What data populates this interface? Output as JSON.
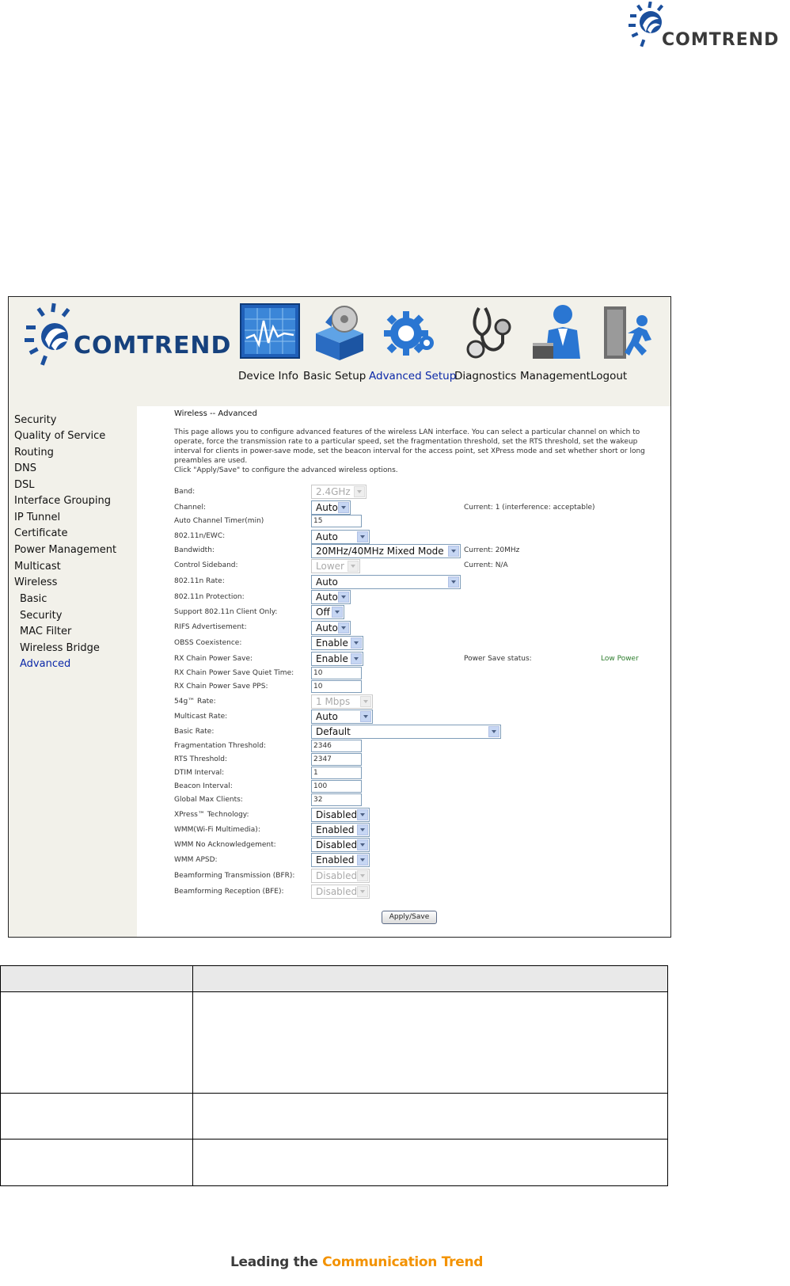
{
  "brand": {
    "name": "COMTREND"
  },
  "nav": {
    "items": [
      {
        "label": "Device Info",
        "icon": "device-info-chart-icon",
        "active": false
      },
      {
        "label": "Basic Setup",
        "icon": "basic-setup-box-icon",
        "active": false
      },
      {
        "label": "Advanced Setup",
        "icon": "advanced-setup-gear-icon",
        "active": true
      },
      {
        "label": "Diagnostics",
        "icon": "diagnostics-stethoscope-icon",
        "active": false
      },
      {
        "label": "Management",
        "icon": "management-person-icon",
        "active": false
      },
      {
        "label": "Logout",
        "icon": "logout-running-man-icon",
        "active": false
      }
    ]
  },
  "sidebar": {
    "items": [
      {
        "label": "Security"
      },
      {
        "label": "Quality of Service"
      },
      {
        "label": "Routing"
      },
      {
        "label": "DNS"
      },
      {
        "label": "DSL"
      },
      {
        "label": "Interface Grouping"
      },
      {
        "label": "IP Tunnel"
      },
      {
        "label": "Certificate"
      },
      {
        "label": "Power Management"
      },
      {
        "label": "Multicast"
      },
      {
        "label": "Wireless"
      },
      {
        "label": "Basic"
      },
      {
        "label": "Security"
      },
      {
        "label": "MAC Filter"
      },
      {
        "label": "Wireless Bridge"
      },
      {
        "label": "Advanced",
        "active": true
      }
    ]
  },
  "page": {
    "title": "Wireless -- Advanced",
    "description_1": "This page allows you to configure advanced features of the wireless LAN interface. You can select a particular channel on which to operate, force the transmission rate to a particular speed, set the fragmentation threshold, set the RTS threshold, set the wakeup interval for clients in power-save mode, set the beacon interval for the access point, set XPress mode and set whether short or long preambles are used.",
    "description_2": "Click \"Apply/Save\" to configure the advanced wireless options."
  },
  "form": {
    "band": {
      "label": "Band:",
      "value": "2.4GHz",
      "disabled": true
    },
    "channel": {
      "label": "Channel:",
      "value": "Auto",
      "note": "Current: 1 (interference: acceptable)"
    },
    "auto_channel_timer": {
      "label": "Auto Channel Timer(min)",
      "value": "15"
    },
    "ewc": {
      "label": "802.11n/EWC:",
      "value": "Auto"
    },
    "bandwidth": {
      "label": "Bandwidth:",
      "value": "20MHz/40MHz Mixed Mode",
      "note": "Current: 20MHz"
    },
    "control_sideband": {
      "label": "Control Sideband:",
      "value": "Lower",
      "disabled": true,
      "note": "Current: N/A"
    },
    "n_rate": {
      "label": "802.11n Rate:",
      "value": "Auto"
    },
    "n_protection": {
      "label": "802.11n Protection:",
      "value": "Auto"
    },
    "support_n_only": {
      "label": "Support 802.11n Client Only:",
      "value": "Off"
    },
    "rifs": {
      "label": "RIFS Advertisement:",
      "value": "Auto"
    },
    "obss": {
      "label": "OBSS Coexistence:",
      "value": "Enable"
    },
    "rx_chain_power_save": {
      "label": "RX Chain Power Save:",
      "value": "Enable",
      "note": "Power Save status:",
      "status": "Low Power"
    },
    "rx_quiet_time": {
      "label": "RX Chain Power Save Quiet Time:",
      "value": "10"
    },
    "rx_pps": {
      "label": "RX Chain Power Save PPS:",
      "value": "10"
    },
    "rate_54g": {
      "label": "54g™ Rate:",
      "value": "1 Mbps",
      "disabled": true
    },
    "multicast_rate": {
      "label": "Multicast Rate:",
      "value": "Auto"
    },
    "basic_rate": {
      "label": "Basic Rate:",
      "value": "Default"
    },
    "frag_threshold": {
      "label": "Fragmentation Threshold:",
      "value": "2346"
    },
    "rts_threshold": {
      "label": "RTS Threshold:",
      "value": "2347"
    },
    "dtim": {
      "label": "DTIM Interval:",
      "value": "1"
    },
    "beacon": {
      "label": "Beacon Interval:",
      "value": "100"
    },
    "max_clients": {
      "label": "Global Max Clients:",
      "value": "32"
    },
    "xpress": {
      "label": "XPress™ Technology:",
      "value": "Disabled"
    },
    "wmm": {
      "label": "WMM(Wi-Fi Multimedia):",
      "value": "Enabled"
    },
    "wmm_noack": {
      "label": "WMM No Acknowledgement:",
      "value": "Disabled"
    },
    "wmm_apsd": {
      "label": "WMM APSD:",
      "value": "Enabled"
    },
    "bfr": {
      "label": "Beamforming Transmission (BFR):",
      "value": "Disabled",
      "disabled": true
    },
    "bfe": {
      "label": "Beamforming Reception (BFE):",
      "value": "Disabled",
      "disabled": true
    },
    "apply_label": "Apply/Save"
  },
  "footer": {
    "part1": "Leading the ",
    "part2": "Communication",
    "part3": " Trend"
  },
  "colors": {
    "brand_blue": "#16417d",
    "active_link": "#0b28a8",
    "footer_orange": "#f39200",
    "status_green": "#2e7d2e"
  }
}
